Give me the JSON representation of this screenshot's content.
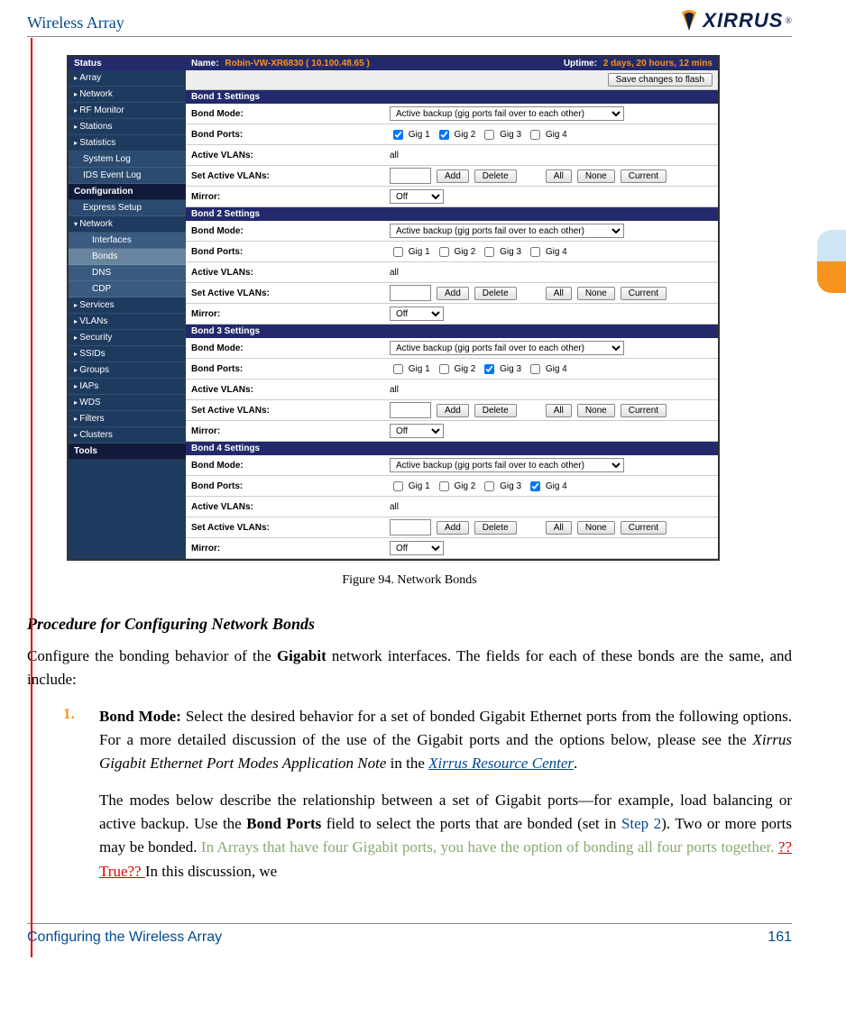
{
  "header": {
    "title": "Wireless Array",
    "logo_text": "XIRRUS"
  },
  "screenshot": {
    "topbar": {
      "status_label": "Status",
      "name_label": "Name:",
      "name_value": "Robin-VW-XR6830   ( 10.100.48.65 )",
      "uptime_label": "Uptime:",
      "uptime_value": "2 days, 20 hours, 12 mins"
    },
    "save_button": "Save changes to flash",
    "sidebar": {
      "status_items": [
        "Array",
        "Network",
        "RF Monitor",
        "Stations",
        "Statistics"
      ],
      "status_subs": [
        "System Log",
        "IDS Event Log"
      ],
      "config_label": "Configuration",
      "config_items_top": [
        "Express Setup"
      ],
      "network_label": "Network",
      "network_subs": [
        "Interfaces",
        "Bonds",
        "DNS",
        "CDP"
      ],
      "config_items_rest": [
        "Services",
        "VLANs",
        "Security",
        "SSIDs",
        "Groups",
        "IAPs",
        "WDS",
        "Filters",
        "Clusters"
      ],
      "tools_label": "Tools"
    },
    "bond_sections": [
      {
        "title": "Bond 1 Settings",
        "checked": [
          true,
          true,
          false,
          false
        ]
      },
      {
        "title": "Bond 2 Settings",
        "checked": [
          false,
          false,
          false,
          false
        ]
      },
      {
        "title": "Bond 3 Settings",
        "checked": [
          false,
          false,
          true,
          false
        ]
      },
      {
        "title": "Bond 4 Settings",
        "checked": [
          false,
          false,
          false,
          true
        ]
      }
    ],
    "row_labels": {
      "mode": "Bond Mode:",
      "ports": "Bond Ports:",
      "vlans": "Active VLANs:",
      "set_vlans": "Set Active VLANs:",
      "mirror": "Mirror:"
    },
    "values": {
      "mode_select": "Active backup (gig ports fail over to each other)",
      "vlans_value": "all",
      "gig_labels": [
        "Gig 1",
        "Gig 2",
        "Gig 3",
        "Gig 4"
      ],
      "buttons": {
        "add": "Add",
        "delete": "Delete",
        "all": "All",
        "none": "None",
        "current": "Current"
      },
      "mirror_select": "Off"
    }
  },
  "caption": "Figure 94. Network Bonds",
  "procedure_heading": "Procedure for Configuring Network Bonds",
  "intro_p1_a": "Configure the bonding behavior of the ",
  "intro_p1_b": "Gigabit",
  "intro_p1_c": " network interfaces. The fields for each of these bonds are the same, and include:",
  "item1": {
    "num": "1.",
    "p1_a": "Bond Mode:",
    "p1_b": " Select the desired behavior for a set of bonded Gigabit Ethernet ports from the following options. For a more detailed discussion of the use of the Gigabit ports and the options below, please see the ",
    "p1_c": "Xirrus Gigabit Ethernet Port Modes Application Note",
    "p1_d": " in the ",
    "p1_e": "Xirrus Resource Center",
    "p1_f": ".",
    "p2_a": "The modes below describe the relationship between a set of Gigabit ports—for example, load balancing or active backup. Use the ",
    "p2_b": "Bond Ports",
    "p2_c": " field to select the ports that are bonded (set in ",
    "p2_d": "Step 2",
    "p2_e": "). Two or more ports may be bonded. ",
    "p2_f": "In Arrays that have four Gigabit ports, you have the option of bonding all four ports together. ",
    "p2_g": "??True?? ",
    "p2_h": "In this discussion, we"
  },
  "footer": {
    "left": "Configuring the Wireless Array",
    "right": "161"
  }
}
